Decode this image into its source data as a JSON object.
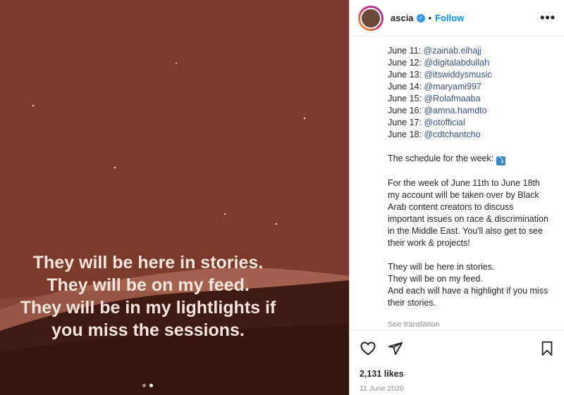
{
  "media": {
    "caption_lines": [
      "They will be here in stories.",
      "They will be on my feed.",
      "They will be in my lightlights if",
      "you miss the sessions."
    ],
    "carousel": {
      "total": 2,
      "active": 2
    }
  },
  "header": {
    "username": "ascia",
    "separator": "•",
    "follow_label": "Follow",
    "more_label": "•••"
  },
  "post": {
    "schedule": [
      {
        "day": "June 11:",
        "handle": "@zainab.elhajj"
      },
      {
        "day": "June 12:",
        "handle": "@digitalabdullah"
      },
      {
        "day": "June 13:",
        "handle": "@itswiddysmusic"
      },
      {
        "day": "June 14:",
        "handle": "@maryami997"
      },
      {
        "day": "June 15:",
        "handle": "@Rolafmaaba"
      },
      {
        "day": "June 16:",
        "handle": "@amna.hamdto"
      },
      {
        "day": "June 17:",
        "handle": "@otofficial"
      },
      {
        "day": "June 18:",
        "handle": "@cdtchantcho"
      }
    ],
    "schedule_intro": "The schedule for the week:",
    "paragraph": "For the week of June 11th to June 18th my account will be taken over by Black Arab content creators to discuss important issues on race & discrimination in the Middle East. You'll also get to see their work & projects!",
    "closing_lines": [
      "They will be here in stories.",
      "They will be on my feed.",
      "And each will have a highlight if you miss their stories."
    ],
    "see_translation": "See translation"
  },
  "footer": {
    "likes": "2,131 likes",
    "date": "11 June 2020"
  },
  "icons": [
    "heart-icon",
    "share-icon",
    "bookmark-icon",
    "verified-icon",
    "down-arrow-emoji-icon"
  ],
  "colors": {
    "link": "#385185",
    "follow": "#0095f6",
    "media_bg": "#7a3b2c"
  }
}
